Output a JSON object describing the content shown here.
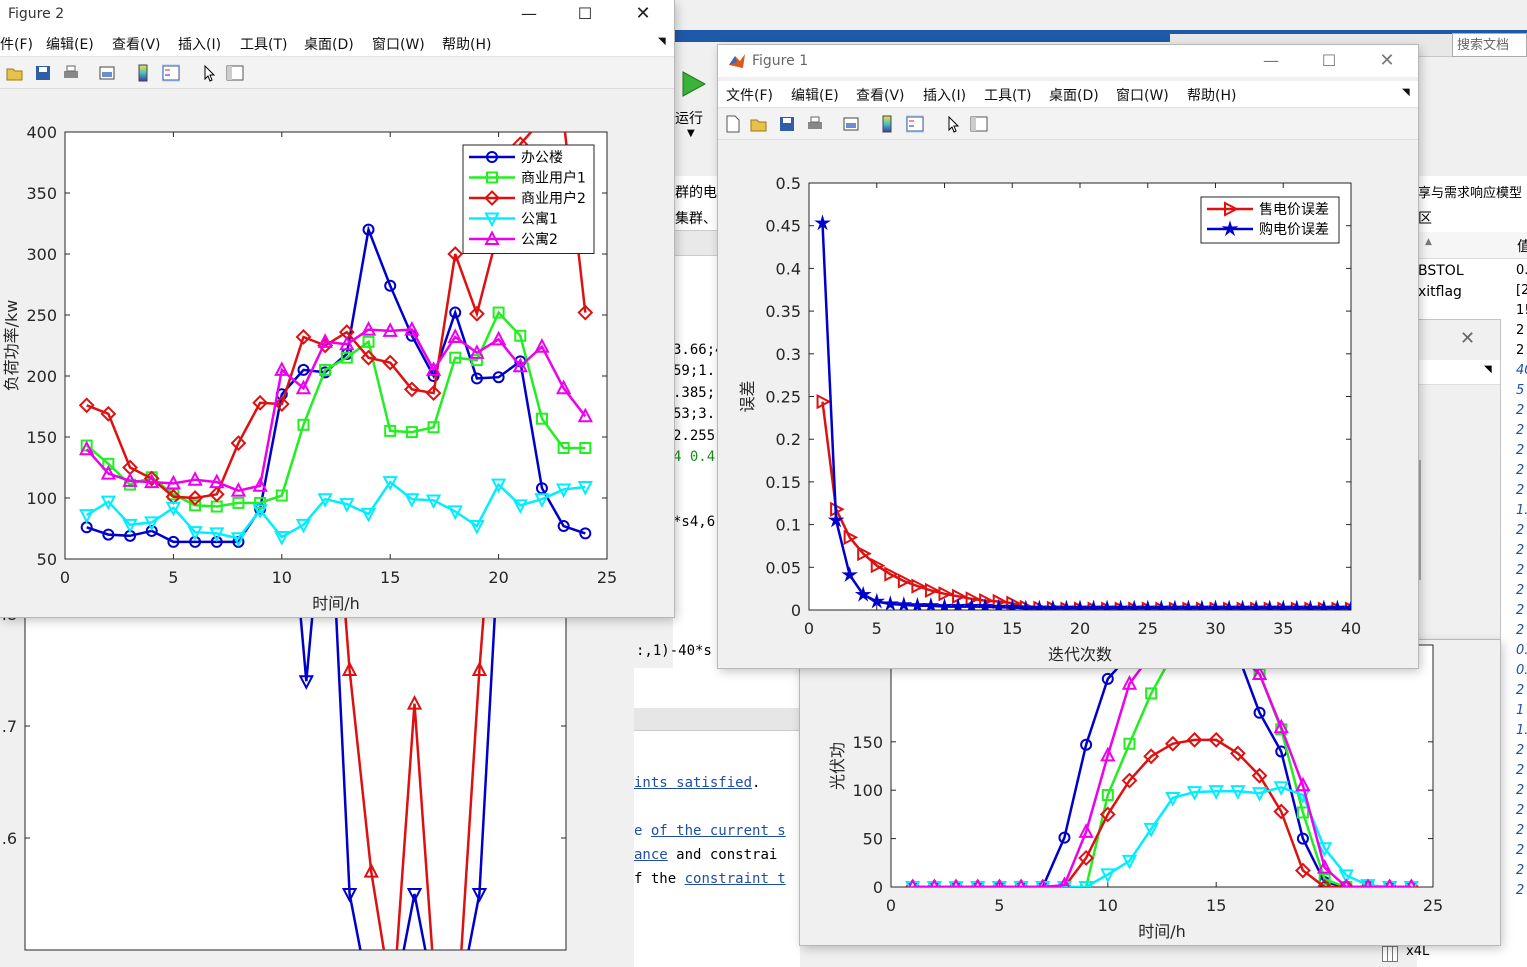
{
  "matlab_bg": {
    "search_placeholder": "搜索文档",
    "run_label": "运行",
    "panel_text_1": "群的电",
    "panel_text_2": "集群、",
    "right_header_1": "享与需求响应模型",
    "right_header_2": "区",
    "right_col_head": "值",
    "ws_names": [
      "BSTOL",
      "xitflag"
    ],
    "ws_values": [
      "0.",
      "[2",
      "1!",
      "2",
      "2",
      "40",
      "5",
      "2",
      "2",
      "2",
      "2",
      "2",
      "1.",
      "2",
      "2",
      "2",
      "2",
      "2",
      "2",
      "0.",
      "0.",
      "2",
      "1",
      "1.",
      "2",
      "2",
      "2",
      "2",
      "2",
      "2",
      "2",
      "2"
    ],
    "code_lines": [
      "3.66;4",
      "59;1.",
      ".385;",
      "53;3.",
      "2.255",
      "4 0.4"
    ],
    "code_line_7": "*s4,6",
    "code_line_8": ":,1)-40*s",
    "cmd_link_1": "ints satisfied",
    "cmd_dot": ".",
    "cmd_line_2a": "e",
    "cmd_line_2b": "of the current s",
    "cmd_link_3": "ance",
    "cmd_line_3b": "and constrai",
    "cmd_line_4a": "f the",
    "cmd_link_4": "constraint t",
    "status_text": "x4L"
  },
  "figure2": {
    "title": "Figure 2",
    "menu": [
      "件(F)",
      "编辑(E)",
      "查看(V)",
      "插入(I)",
      "工具(T)",
      "桌面(D)",
      "窗口(W)",
      "帮助(H)"
    ]
  },
  "figure1": {
    "title": "Figure 1",
    "menu": [
      "文件(F)",
      "编辑(E)",
      "查看(V)",
      "插入(I)",
      "工具(T)",
      "桌面(D)",
      "窗口(W)",
      "帮助(H)"
    ]
  },
  "chart_data": [
    {
      "id": "load",
      "type": "line",
      "title": "",
      "xlabel": "时间/h",
      "ylabel": "负荷功率/kw",
      "xlim": [
        0,
        25
      ],
      "ylim": [
        50,
        400
      ],
      "xticks": [
        0,
        5,
        10,
        15,
        20,
        25
      ],
      "yticks": [
        50,
        100,
        150,
        200,
        250,
        300,
        350,
        400
      ],
      "legend_position": "top-right",
      "x": [
        1,
        2,
        3,
        4,
        5,
        6,
        7,
        8,
        9,
        10,
        11,
        12,
        13,
        14,
        15,
        16,
        17,
        18,
        19,
        20,
        21,
        22,
        23,
        24
      ],
      "series": [
        {
          "name": "办公楼",
          "color": "#0000cc",
          "marker": "circle",
          "values": [
            76,
            70,
            69,
            73,
            64,
            64,
            64,
            64,
            91,
            185,
            205,
            203,
            218,
            320,
            274,
            233,
            200,
            252,
            198,
            199,
            212,
            108,
            77,
            71
          ]
        },
        {
          "name": "商业用户1",
          "color": "#22ee22",
          "marker": "square",
          "values": [
            143,
            128,
            111,
            117,
            103,
            94,
            93,
            96,
            96,
            102,
            160,
            205,
            215,
            228,
            155,
            154,
            158,
            215,
            213,
            252,
            233,
            165,
            141,
            141
          ]
        },
        {
          "name": "商业用户2",
          "color": "#dd1111",
          "marker": "diamond",
          "values": [
            176,
            169,
            125,
            116,
            101,
            100,
            103,
            145,
            178,
            177,
            232,
            225,
            236,
            215,
            211,
            189,
            186,
            300,
            251,
            320,
            390,
            410,
            410,
            252
          ]
        },
        {
          "name": "公寓1",
          "color": "#00eeff",
          "marker": "triangle-down",
          "values": [
            86,
            97,
            78,
            80,
            92,
            72,
            71,
            67,
            90,
            68,
            78,
            99,
            95,
            87,
            113,
            99,
            98,
            89,
            77,
            111,
            94,
            99,
            107,
            109
          ]
        },
        {
          "name": "公寓2",
          "color": "#ee00ee",
          "marker": "triangle-up",
          "values": [
            140,
            120,
            114,
            113,
            112,
            115,
            113,
            106,
            110,
            205,
            190,
            228,
            226,
            238,
            237,
            238,
            205,
            232,
            219,
            230,
            208,
            224,
            190,
            167
          ]
        }
      ]
    },
    {
      "id": "error",
      "type": "line",
      "title": "",
      "xlabel": "迭代次数",
      "ylabel": "误差",
      "xlim": [
        0,
        40
      ],
      "ylim": [
        0,
        0.5
      ],
      "xticks": [
        0,
        5,
        10,
        15,
        20,
        25,
        30,
        35,
        40
      ],
      "yticks": [
        0,
        0.05,
        0.1,
        0.15,
        0.2,
        0.25,
        0.3,
        0.35,
        0.4,
        0.45,
        0.5
      ],
      "legend_position": "top-right",
      "x": [
        1,
        2,
        3,
        4,
        5,
        6,
        7,
        8,
        9,
        10,
        11,
        12,
        13,
        14,
        15,
        16,
        17,
        18,
        19,
        20,
        21,
        22,
        23,
        24,
        25,
        26,
        27,
        28,
        29,
        30,
        31,
        32,
        33,
        34,
        35,
        36,
        37,
        38,
        39,
        40
      ],
      "series": [
        {
          "name": "售电价误差",
          "color": "#dd1111",
          "marker": "triangle-right",
          "values": [
            0.244,
            0.118,
            0.085,
            0.066,
            0.052,
            0.042,
            0.034,
            0.028,
            0.023,
            0.019,
            0.016,
            0.013,
            0.011,
            0.01,
            0.008,
            0.003,
            0.002,
            0.002,
            0.001,
            0.001,
            0.001,
            0.001,
            0.001,
            0.001,
            0.001,
            0.001,
            0.001,
            0.001,
            0.001,
            0.001,
            0.001,
            0.001,
            0.001,
            0.001,
            0.001,
            0.001,
            0.001,
            0.001,
            0.001,
            0.001
          ]
        },
        {
          "name": "购电价误差",
          "color": "#0000cc",
          "marker": "star",
          "values": [
            0.453,
            0.105,
            0.041,
            0.018,
            0.01,
            0.007,
            0.006,
            0.005,
            0.005,
            0.004,
            0.004,
            0.004,
            0.004,
            0.003,
            0.003,
            0.002,
            0.002,
            0.002,
            0.002,
            0.002,
            0.002,
            0.002,
            0.002,
            0.002,
            0.002,
            0.002,
            0.002,
            0.002,
            0.002,
            0.002,
            0.002,
            0.002,
            0.002,
            0.002,
            0.002,
            0.002,
            0.002,
            0.002,
            0.002,
            0.002
          ]
        }
      ]
    },
    {
      "id": "pv",
      "type": "line",
      "title": "",
      "xlabel": "时间/h",
      "ylabel": "光伏功",
      "xlim": [
        0,
        25
      ],
      "ylim": [
        0,
        250
      ],
      "xticks": [
        0,
        5,
        10,
        15,
        20,
        25
      ],
      "yticks": [
        0,
        50,
        100,
        150
      ],
      "x": [
        1,
        2,
        3,
        4,
        5,
        6,
        7,
        8,
        9,
        10,
        11,
        12,
        13,
        14,
        15,
        16,
        17,
        18,
        19,
        20,
        21,
        22,
        23,
        24
      ],
      "series": [
        {
          "color": "#0000cc",
          "marker": "circle",
          "values": [
            0,
            0,
            0,
            0,
            0,
            0,
            0,
            51,
            147,
            215,
            240,
            245,
            245,
            245,
            245,
            240,
            180,
            140,
            50,
            5,
            0,
            0,
            0,
            0
          ]
        },
        {
          "color": "#22ee22",
          "marker": "square",
          "values": [
            0,
            0,
            0,
            0,
            0,
            0,
            0,
            0,
            0,
            95,
            148,
            200,
            240,
            245,
            245,
            240,
            220,
            163,
            77,
            8,
            0,
            0,
            0,
            0
          ]
        },
        {
          "color": "#dd1111",
          "marker": "diamond",
          "values": [
            0,
            0,
            0,
            0,
            0,
            0,
            0,
            0,
            30,
            75,
            110,
            135,
            148,
            152,
            152,
            138,
            115,
            78,
            17,
            0,
            0,
            0,
            0,
            0
          ]
        },
        {
          "color": "#00eeff",
          "marker": "triangle-down",
          "values": [
            0,
            0,
            0,
            0,
            0,
            0,
            0,
            0,
            0,
            13,
            27,
            60,
            92,
            98,
            99,
            99,
            97,
            103,
            95,
            40,
            12,
            2,
            0,
            0
          ]
        },
        {
          "color": "#ee00ee",
          "marker": "triangle-up",
          "values": [
            0,
            0,
            0,
            0,
            0,
            0,
            0,
            2,
            57,
            136,
            210,
            240,
            240,
            240,
            240,
            240,
            220,
            165,
            105,
            20,
            0,
            0,
            0,
            0
          ]
        }
      ]
    },
    {
      "id": "bottom_left",
      "type": "line",
      "title": "",
      "ylim": [
        0.5,
        1.0
      ],
      "yticks": [
        0.6,
        0.7,
        0.8,
        0.9
      ],
      "ytick_labels": [
        ".6",
        ".7",
        ".8",
        ".9"
      ],
      "x": [
        1,
        2,
        3,
        4,
        5,
        6,
        7,
        8,
        9,
        10,
        11,
        12,
        13,
        14,
        15,
        16,
        17,
        18,
        19,
        20,
        21,
        22,
        23,
        24
      ],
      "series": [
        {
          "color": "#0000cc",
          "marker": "triangle-down",
          "values": [
            1.0,
            1.0,
            1.0,
            1.0,
            1.0,
            1.0,
            1.0,
            1.0,
            1.0,
            1.0,
            1.0,
            0.96,
            0.74,
            0.95,
            0.55,
            0.45,
            0.45,
            0.55,
            0.45,
            0.45,
            0.55,
            0.9,
            1.0,
            1.0
          ]
        },
        {
          "color": "#dd1111",
          "marker": "triangle-up",
          "values": [
            1.0,
            1.0,
            1.0,
            1.0,
            1.0,
            1.0,
            1.0,
            1.0,
            1.0,
            1.0,
            1.0,
            1.0,
            0.94,
            1.0,
            0.75,
            0.57,
            0.45,
            0.72,
            0.45,
            0.45,
            0.75,
            1.0,
            1.0,
            1.0
          ]
        }
      ]
    }
  ]
}
